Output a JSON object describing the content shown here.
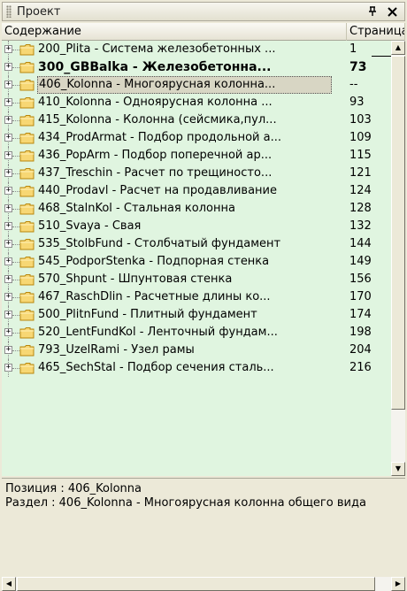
{
  "panel": {
    "title": "Проект",
    "pin_icon": "pin-icon",
    "close_icon": "close-icon",
    "pin_glyph": "ꟼ",
    "close_glyph": "✕"
  },
  "columns": {
    "content": "Содержание",
    "page": "Страница"
  },
  "items": [
    {
      "label": "200_Plita - Система железобетонных ...",
      "page": "1",
      "bold": false,
      "selected": false
    },
    {
      "label": "300_GBBalka - Железобетонна...",
      "page": "73",
      "bold": true,
      "selected": false
    },
    {
      "label": "406_Kolonna - Многоярусная колонна...",
      "page": "--",
      "bold": false,
      "selected": true
    },
    {
      "label": "410_Kolonna - Одноярусная колонна ...",
      "page": "93",
      "bold": false,
      "selected": false
    },
    {
      "label": "415_Kolonna - Колонна (сейсмика,пул...",
      "page": "103",
      "bold": false,
      "selected": false
    },
    {
      "label": "434_ProdArmat - Подбор продольной а...",
      "page": "109",
      "bold": false,
      "selected": false
    },
    {
      "label": "436_PopArm - Подбор поперечной ар...",
      "page": "115",
      "bold": false,
      "selected": false
    },
    {
      "label": "437_Treschin - Расчет по трещиносто...",
      "page": "121",
      "bold": false,
      "selected": false
    },
    {
      "label": "440_Prodavl - Расчет на продавливание",
      "page": "124",
      "bold": false,
      "selected": false
    },
    {
      "label": "468_StalnKol - Стальная колонна",
      "page": "128",
      "bold": false,
      "selected": false
    },
    {
      "label": "510_Svaya - Свая",
      "page": "132",
      "bold": false,
      "selected": false
    },
    {
      "label": "535_StolbFund - Столбчатый фундамент",
      "page": "144",
      "bold": false,
      "selected": false
    },
    {
      "label": "545_PodporStenka - Подпорная стенка",
      "page": "149",
      "bold": false,
      "selected": false
    },
    {
      "label": "570_Shpunt - Шпунтовая стенка",
      "page": "156",
      "bold": false,
      "selected": false
    },
    {
      "label": "467_RaschDlin - Расчетные длины ко...",
      "page": "170",
      "bold": false,
      "selected": false
    },
    {
      "label": "500_PlitnFund - Плитный фундамент",
      "page": "174",
      "bold": false,
      "selected": false
    },
    {
      "label": "520_LentFundKol - Ленточный фундам...",
      "page": "198",
      "bold": false,
      "selected": false
    },
    {
      "label": "793_UzelRami - Узел рамы",
      "page": "204",
      "bold": false,
      "selected": false
    },
    {
      "label": "465_SechStal - Подбор сечения сталь...",
      "page": "216",
      "bold": false,
      "selected": false
    }
  ],
  "info": {
    "position": "Позиция : 406_Kolonna",
    "section": "Раздел : 406_Kolonna - Многоярусная колонна общего вида"
  },
  "colors": {
    "list_bg": "#e0f5e0",
    "chrome_bg": "#ece9d8"
  }
}
